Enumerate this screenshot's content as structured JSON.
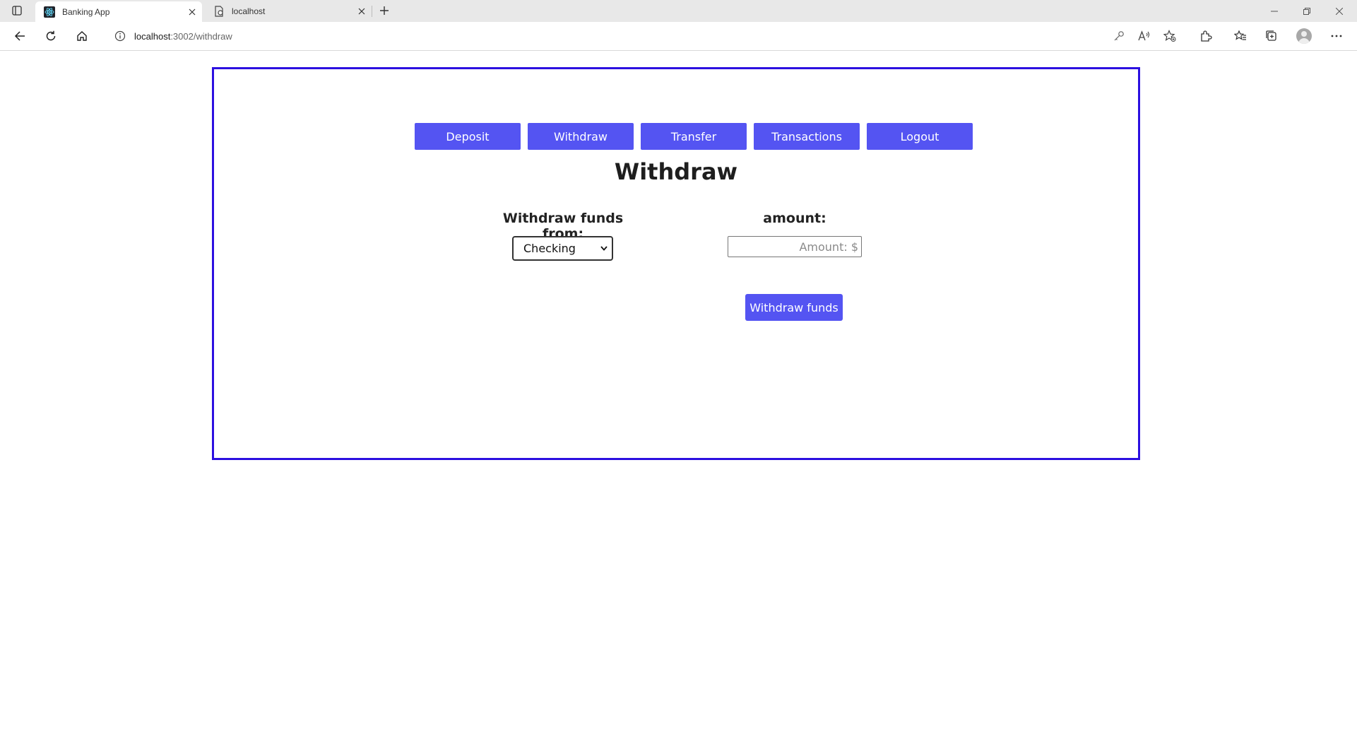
{
  "browser": {
    "tabs": [
      {
        "title": "Banking App",
        "active": true,
        "favicon": "react-icon"
      },
      {
        "title": "localhost",
        "active": false,
        "favicon": "page-icon"
      }
    ],
    "address": {
      "host": "localhost",
      "path": ":3002/withdraw"
    }
  },
  "nav": {
    "buttons": [
      "Deposit",
      "Withdraw",
      "Transfer",
      "Transactions",
      "Logout"
    ]
  },
  "page": {
    "title": "Withdraw",
    "from_label": "Withdraw funds from:",
    "account_selected": "Checking",
    "amount_label": "amount:",
    "amount_placeholder": "Amount: $",
    "submit_label": "Withdraw funds"
  },
  "colors": {
    "accent": "#5454f2",
    "frame_border": "#2c10e0"
  }
}
